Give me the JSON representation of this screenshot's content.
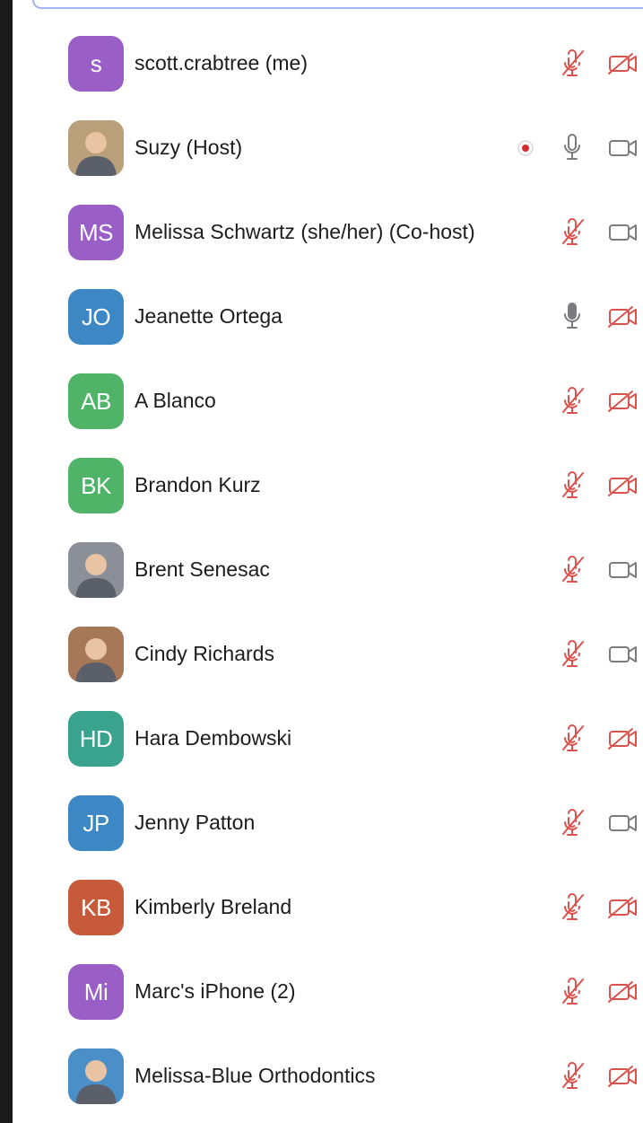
{
  "participants": [
    {
      "name": "scott.crabtree (me)",
      "initials": "s",
      "avatar_color": "#9a5fc7",
      "avatar_photo": false,
      "mic": "muted",
      "video": "off",
      "recording": false
    },
    {
      "name": "Suzy (Host)",
      "initials": "",
      "avatar_color": "#b9a07a",
      "avatar_photo": true,
      "mic": "on",
      "video": "on",
      "recording": true
    },
    {
      "name": "Melissa Schwartz (she/her) (Co-host)",
      "initials": "MS",
      "avatar_color": "#9a5fc7",
      "avatar_photo": false,
      "mic": "muted",
      "video": "on",
      "recording": false
    },
    {
      "name": "Jeanette Ortega",
      "initials": "JO",
      "avatar_color": "#3d87c4",
      "avatar_photo": false,
      "mic": "speaking",
      "video": "off",
      "recording": false
    },
    {
      "name": "A Blanco",
      "initials": "AB",
      "avatar_color": "#4fb468",
      "avatar_photo": false,
      "mic": "muted",
      "video": "off",
      "recording": false
    },
    {
      "name": "Brandon Kurz",
      "initials": "BK",
      "avatar_color": "#4fb468",
      "avatar_photo": false,
      "mic": "muted",
      "video": "off",
      "recording": false
    },
    {
      "name": "Brent Senesac",
      "initials": "",
      "avatar_color": "#8a8f98",
      "avatar_photo": true,
      "mic": "muted",
      "video": "on",
      "recording": false
    },
    {
      "name": "Cindy Richards",
      "initials": "",
      "avatar_color": "#a67858",
      "avatar_photo": true,
      "mic": "muted",
      "video": "on",
      "recording": false
    },
    {
      "name": "Hara Dembowski",
      "initials": "HD",
      "avatar_color": "#3aa38d",
      "avatar_photo": false,
      "mic": "muted",
      "video": "off",
      "recording": false
    },
    {
      "name": "Jenny Patton",
      "initials": "JP",
      "avatar_color": "#3d87c4",
      "avatar_photo": false,
      "mic": "muted",
      "video": "on",
      "recording": false
    },
    {
      "name": "Kimberly Breland",
      "initials": "KB",
      "avatar_color": "#c65a3a",
      "avatar_photo": false,
      "mic": "muted",
      "video": "off",
      "recording": false
    },
    {
      "name": "Marc's iPhone (2)",
      "initials": "Mi",
      "avatar_color": "#9a5fc7",
      "avatar_photo": false,
      "mic": "muted",
      "video": "off",
      "recording": false
    },
    {
      "name": "Melissa-Blue Orthodontics",
      "initials": "",
      "avatar_color": "#4a8fc8",
      "avatar_photo": true,
      "mic": "muted",
      "video": "off",
      "recording": false
    }
  ],
  "colors": {
    "muted_red": "#d9534f",
    "icon_gray": "#7b7b80",
    "recording_red": "#d32f2f"
  }
}
